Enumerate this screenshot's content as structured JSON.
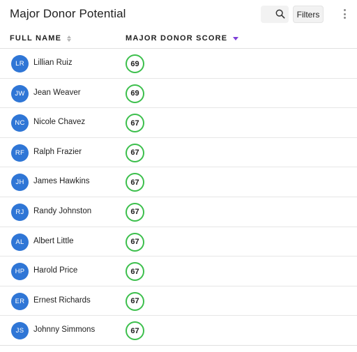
{
  "header": {
    "title": "Major Donor Potential",
    "search_icon": "search-icon",
    "filters_label": "Filters",
    "more_icon": "more-vert-icon"
  },
  "columns": {
    "name": "FULL NAME",
    "score": "MAJOR DONOR SCORE",
    "sort_direction": "descending"
  },
  "colors": {
    "avatar": "#2f76d6",
    "score_ring": "#3cbf4c",
    "sort_active": "#7e3fd8"
  },
  "rows": [
    {
      "initials": "LR",
      "name": "Lillian Ruiz",
      "score": "69"
    },
    {
      "initials": "JW",
      "name": "Jean Weaver",
      "score": "69"
    },
    {
      "initials": "NC",
      "name": "Nicole Chavez",
      "score": "67"
    },
    {
      "initials": "RF",
      "name": "Ralph Frazier",
      "score": "67"
    },
    {
      "initials": "JH",
      "name": "James Hawkins",
      "score": "67"
    },
    {
      "initials": "RJ",
      "name": "Randy Johnston",
      "score": "67"
    },
    {
      "initials": "AL",
      "name": "Albert Little",
      "score": "67"
    },
    {
      "initials": "HP",
      "name": "Harold Price",
      "score": "67"
    },
    {
      "initials": "ER",
      "name": "Ernest Richards",
      "score": "67"
    },
    {
      "initials": "JS",
      "name": "Johnny Simmons",
      "score": "67"
    }
  ]
}
